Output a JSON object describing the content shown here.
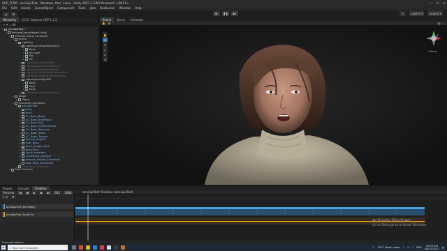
{
  "window": {
    "title": "URP_FCRR - arculipsTest - Windows, Mac, Linux - Unity 2021.3.19f1 Personal* <DX11>"
  },
  "menu": [
    "File",
    "Edit",
    "Assets",
    "GameObject",
    "Component",
    "Tools",
    "Jobs",
    "Reallusion",
    "Window",
    "Help"
  ],
  "toolbar": {
    "layers": "Layers",
    "layout": "Layout",
    "account": "Account"
  },
  "hierarchy": {
    "tab": "Hierarchy",
    "tab2": "CC/iC Importer URP 1.4.2",
    "search_placeholder": "All",
    "rows": [
      {
        "t": "arculipsTest*",
        "lvl": 0,
        "cls": "hdr"
      },
      {
        "t": "PreviewSceneHelperClone)",
        "lvl": 1
      },
      {
        "t": "Preview Scene Container",
        "lvl": 2
      },
      {
        "t": "Scene",
        "lvl": 3
      },
      {
        "t": "Lighting",
        "lvl": 4
      },
      {
        "t": "LightingConfig-Authority2",
        "lvl": 5
      },
      {
        "t": "Back",
        "lvl": 6
      },
      {
        "t": "Dir Light",
        "lvl": 6
      },
      {
        "t": "Key",
        "lvl": 6
      },
      {
        "t": "Fill",
        "lvl": 6
      },
      {
        "t": "LightingConfig-Studio",
        "lvl": 5,
        "cls": "dim"
      },
      {
        "t": "LightingConfig-BroadStyle",
        "lvl": 5,
        "cls": "dim"
      },
      {
        "t": "LightingConfig-Brightside",
        "lvl": 5,
        "cls": "dim"
      },
      {
        "t": "LightingConfig-SmallHouseSpot",
        "lvl": 5,
        "cls": "dim"
      },
      {
        "t": "LightingConfig-BrightStartSpot",
        "lvl": 5,
        "cls": "dim"
      },
      {
        "t": "LightingConfig-URP",
        "lvl": 5
      },
      {
        "t": "Back",
        "lvl": 6
      },
      {
        "t": "Key1",
        "lvl": 6
      },
      {
        "t": "Key2",
        "lvl": 6
      },
      {
        "t": "LightingConfig-CCdefault",
        "lvl": 5,
        "cls": "dim"
      },
      {
        "t": "Stage",
        "lvl": 3
      },
      {
        "t": "Plane",
        "lvl": 4
      },
      {
        "t": "Character Container",
        "lvl": 3
      },
      {
        "t": "arculipsTest",
        "lvl": 4,
        "cls": "blue"
      },
      {
        "t": "Body",
        "lvl": 5,
        "cls": "blue"
      },
      {
        "t": "Bury",
        "lvl": 5,
        "cls": "blue"
      },
      {
        "t": "CC_Base_Body",
        "lvl": 5,
        "cls": "blue"
      },
      {
        "t": "CC_Base_BoneRoot",
        "lvl": 5,
        "cls": "blue"
      },
      {
        "t": "CC_Base_Eye",
        "lvl": 5,
        "cls": "blue"
      },
      {
        "t": "CC_Base_EyeOcclusion",
        "lvl": 5,
        "cls": "blue"
      },
      {
        "t": "CC_Base_TearLine",
        "lvl": 5,
        "cls": "blue"
      },
      {
        "t": "CC_Base_Teeth",
        "lvl": 5,
        "cls": "blue"
      },
      {
        "t": "CC_Base_Tongue",
        "lvl": 5,
        "cls": "blue"
      },
      {
        "t": "Female_Angled",
        "lvl": 5,
        "cls": "blue"
      },
      {
        "t": "Foot_Base",
        "lvl": 5,
        "cls": "blue"
      },
      {
        "t": "Knee_length_skirt",
        "lvl": 5,
        "cls": "blue"
      },
      {
        "t": "Rmd.Ultra",
        "lvl": 5,
        "cls": "blue"
      },
      {
        "t": "Sport_sneakers",
        "lvl": 5,
        "cls": "blue"
      },
      {
        "t": "Turtleneck_sweater",
        "lvl": 5,
        "cls": "blue"
      },
      {
        "t": "Female_Angled_Extracted",
        "lvl": 5,
        "cls": "blue"
      },
      {
        "t": "Foot_Base_Extracted",
        "lvl": 5,
        "cls": "blue"
      },
      {
        "t": "Character Container",
        "lvl": 4,
        "cls": "dim"
      },
      {
        "t": "Main Camera",
        "lvl": 2
      }
    ]
  },
  "scene": {
    "tabs": [
      "Scene",
      "Game",
      "Animator"
    ],
    "persp": "< Persp"
  },
  "bottom": {
    "tabs": [
      "Project",
      "Console",
      "Timeline"
    ],
    "preview": "Preview",
    "frame": "882",
    "frame2": "1884",
    "timeline_title": "arculipsTest Timeline (arculipsTest)",
    "tracks": [
      {
        "label": "arculipsTest (Animator)",
        "color": "#4aa3df"
      },
      {
        "label": "arculipsTest (Audio So",
        "color": "#f0a21b"
      }
    ]
  },
  "status": {
    "text": "EnteredEditMode"
  },
  "watermark": {
    "line1": "Activate Windows",
    "line2": "Go to Settings to activate Windows."
  },
  "taskbar": {
    "search_placeholder": "Type here to search",
    "weather": "26°C Mostly clear",
    "lang": "ENG",
    "time": "12:53 AM",
    "date": "06/12/2023"
  }
}
